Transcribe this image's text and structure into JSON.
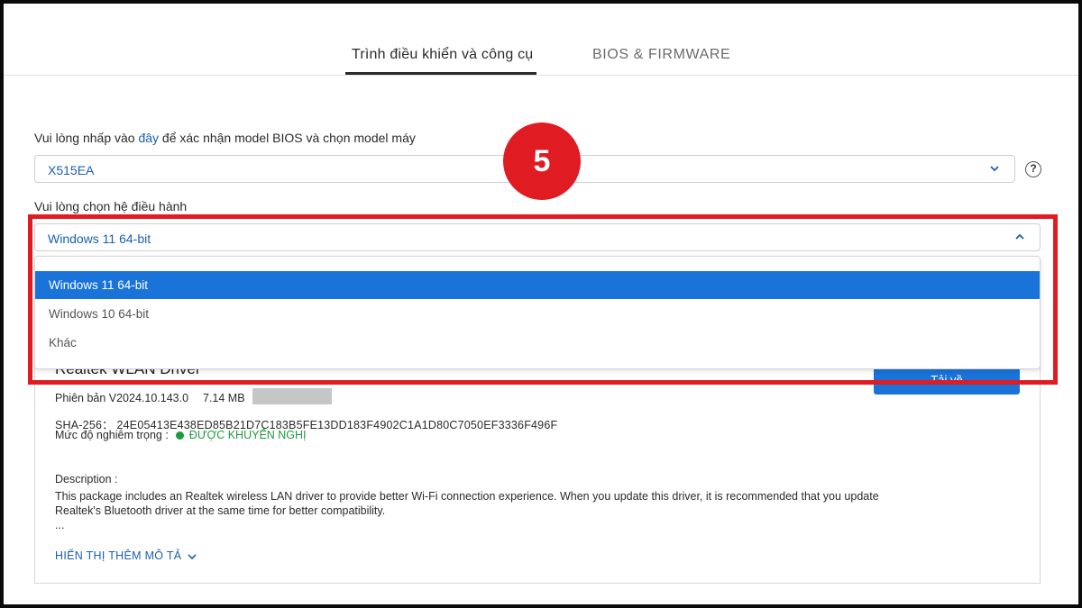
{
  "tabs": [
    {
      "label": "Trình điều khiển và công cụ",
      "active": true
    },
    {
      "label": "BIOS & FIRMWARE",
      "active": false
    }
  ],
  "model": {
    "label_prefix": "Vui lòng nhấp vào ",
    "label_link": "đây",
    "label_suffix": " để xác nhận model BIOS và chọn model máy",
    "value": "X515EA"
  },
  "os": {
    "label": "Vui lòng chọn hệ điều hành",
    "value": "Windows 11 64-bit",
    "options": [
      "Windows 11 64-bit",
      "Windows 10 64-bit",
      "Khác"
    ],
    "selected_index": 0
  },
  "step_badge": "5",
  "driver": {
    "title": "Realtek WLAN Driver",
    "download_label": "Tải về",
    "version": "Phiên bản V2024.10.143.0",
    "size": "7.14 MB",
    "sha": "SHA-256： 24E05413E438ED85B21D7C183B5FE13DD183F4902C1A1D80C7050EF3336F496F",
    "severity_label": "Mức độ nghiêm trọng :",
    "severity_value": "ĐƯỢC KHUYẾN NGHỊ",
    "description_heading": "Description :",
    "description": "This package includes an Realtek wireless LAN driver to provide better Wi-Fi connection experience. When you update this driver, it is recommended that you update Realtek's Bluetooth driver at the same time for better compatibility.",
    "ellipsis": "...",
    "show_more": "HIỂN THỊ THÊM MÔ TẢ"
  },
  "colors": {
    "accent": "#1a73d9",
    "highlight": "#e01b22",
    "success": "#1f9a3f"
  }
}
